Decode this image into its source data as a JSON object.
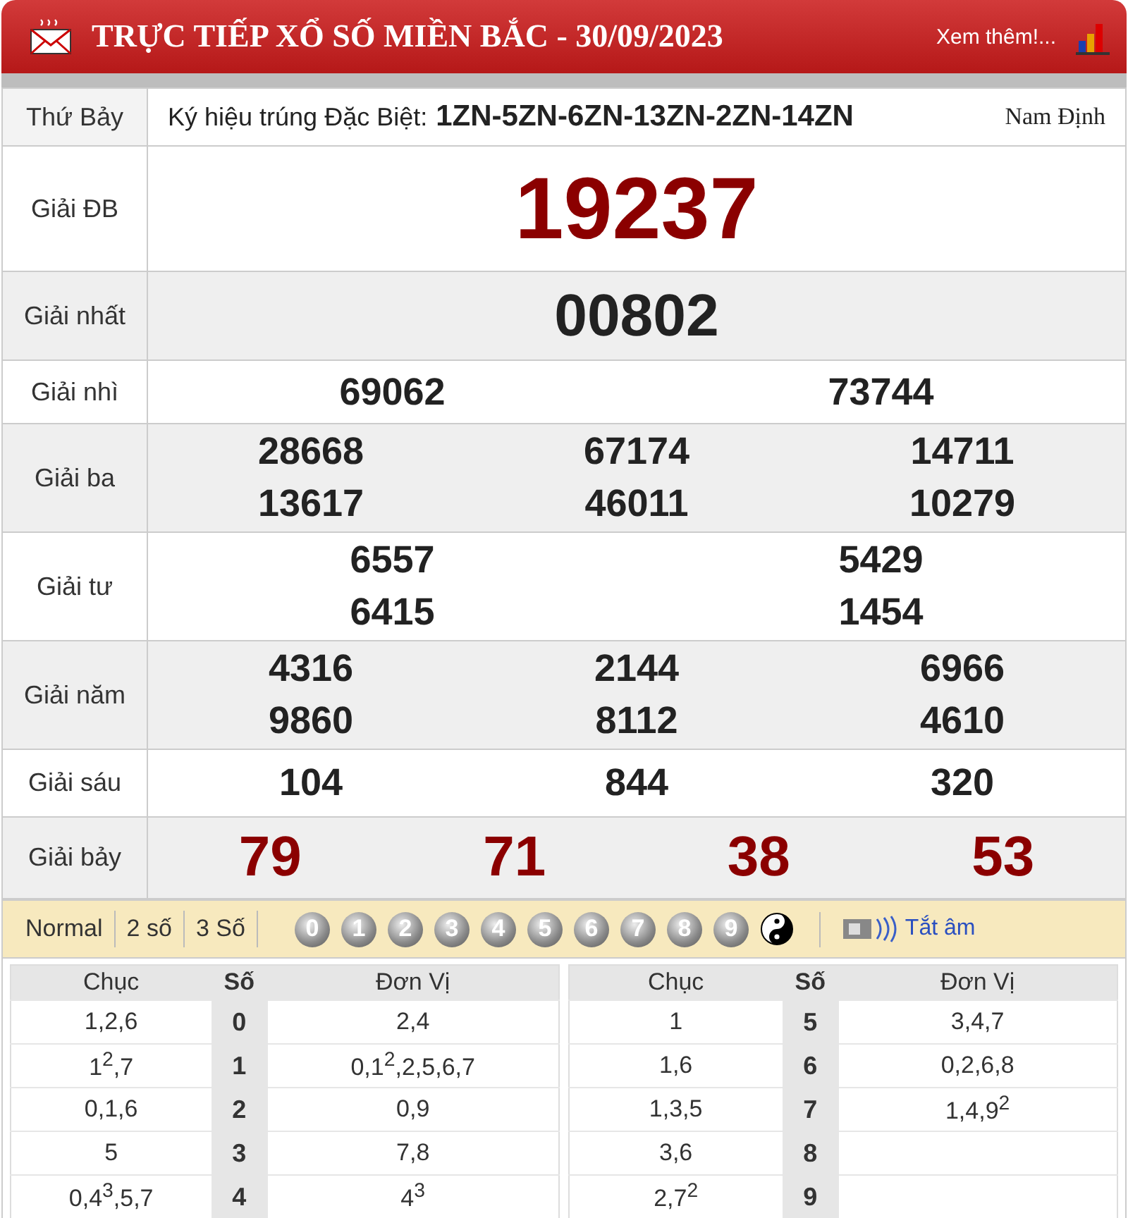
{
  "header": {
    "title": "TRỰC TIẾP XỔ SỐ MIỀN BẮC - 30/09/2023",
    "more_link": "Xem thêm!..."
  },
  "info": {
    "day": "Thứ Bảy",
    "code_label": "Ký hiệu trúng Đặc Biệt:",
    "code": "1ZN-5ZN-6ZN-13ZN-2ZN-14ZN",
    "province": "Nam Định"
  },
  "prizes": [
    {
      "label": "Giải ĐB",
      "kind": "special",
      "numbers": [
        "19237"
      ]
    },
    {
      "label": "Giải nhất",
      "kind": "first",
      "numbers": [
        "00802"
      ]
    },
    {
      "label": "Giải nhì",
      "kind": "pair",
      "numbers": [
        "69062",
        "73744"
      ]
    },
    {
      "label": "Giải ba",
      "kind": "triple",
      "numbers": [
        "28668",
        "67174",
        "14711",
        "13617",
        "46011",
        "10279"
      ]
    },
    {
      "label": "Giải tư",
      "kind": "pair",
      "numbers": [
        "6557",
        "5429",
        "6415",
        "1454"
      ]
    },
    {
      "label": "Giải năm",
      "kind": "triple",
      "numbers": [
        "4316",
        "2144",
        "6966",
        "9860",
        "8112",
        "4610"
      ]
    },
    {
      "label": "Giải sáu",
      "kind": "triple",
      "numbers": [
        "104",
        "844",
        "320"
      ]
    },
    {
      "label": "Giải bảy",
      "kind": "seventh",
      "numbers": [
        "79",
        "71",
        "38",
        "53"
      ]
    }
  ],
  "toolbar": {
    "modes": [
      "Normal",
      "2 số",
      "3 Số"
    ],
    "digits": [
      "0",
      "1",
      "2",
      "3",
      "4",
      "5",
      "6",
      "7",
      "8",
      "9"
    ],
    "mute_label": "Tắt âm"
  },
  "loto": {
    "halves": [
      {
        "columns": [
          "Chục",
          "Số",
          "Đơn Vị"
        ],
        "rows": [
          {
            "tens": "1,2,6",
            "head": "0",
            "units": "2,4"
          },
          {
            "tens": "1$^{2}$,7",
            "head": "1",
            "units": "0,1$^{2}$,2,5,6,7"
          },
          {
            "tens": "0,1,6",
            "head": "2",
            "units": "0,9"
          },
          {
            "tens": "5",
            "head": "3",
            "units": "7,8"
          },
          {
            "tens": "0,4$^{3}$,5,7",
            "head": "4",
            "units": "4$^{3}$"
          }
        ]
      },
      {
        "columns": [
          "Chục",
          "Số",
          "Đơn Vị"
        ],
        "rows": [
          {
            "tens": "1",
            "head": "5",
            "units": "3,4,7"
          },
          {
            "tens": "1,6",
            "head": "6",
            "units": "0,2,6,8"
          },
          {
            "tens": "1,3,5",
            "head": "7",
            "units": "1,4,9$^{2}$"
          },
          {
            "tens": "3,6",
            "head": "8"
          },
          {
            "tens": "2,7$^{2}$",
            "head": "9"
          }
        ]
      }
    ]
  }
}
